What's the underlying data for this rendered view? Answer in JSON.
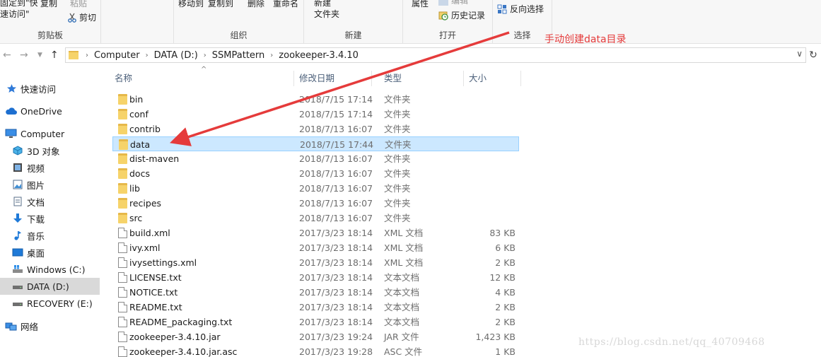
{
  "ribbon": {
    "pin_label": "固定到\"快\n速访问\"",
    "copy_label": "复制",
    "paste_label": "粘贴",
    "cut_label": "剪切",
    "clipboard_group": "剪贴板",
    "move_to_label": "移动到",
    "copy_to_label": "复制到",
    "delete_label": "删除",
    "rename_label": "重命名",
    "organize_group": "组织",
    "new_folder_label": "新建\n文件夹",
    "new_group": "新建",
    "properties_label": "属性",
    "edit_label": "编辑",
    "history_label": "历史记录",
    "open_group": "打开",
    "invert_selection_label": "反向选择",
    "select_group": "选择"
  },
  "address": {
    "crumbs": [
      "Computer",
      "DATA (D:)",
      "SSMPattern",
      "zookeeper-3.4.10"
    ]
  },
  "sidebar": {
    "items": [
      {
        "label": "快速访问",
        "icon": "star-icon"
      },
      {
        "label": "OneDrive",
        "icon": "cloud-icon"
      },
      {
        "label": "Computer",
        "icon": "computer-icon"
      },
      {
        "label": "3D 对象",
        "icon": "cube-icon"
      },
      {
        "label": "视频",
        "icon": "video-icon"
      },
      {
        "label": "图片",
        "icon": "picture-icon"
      },
      {
        "label": "文档",
        "icon": "document-icon"
      },
      {
        "label": "下载",
        "icon": "download-icon"
      },
      {
        "label": "音乐",
        "icon": "music-icon"
      },
      {
        "label": "桌面",
        "icon": "desktop-icon"
      },
      {
        "label": "Windows (C:)",
        "icon": "drive-icon"
      },
      {
        "label": "DATA (D:)",
        "icon": "drive-icon",
        "selected": true
      },
      {
        "label": "RECOVERY (E:)",
        "icon": "drive-icon"
      },
      {
        "label": "网络",
        "icon": "network-icon"
      }
    ]
  },
  "columns": {
    "name": "名称",
    "date": "修改日期",
    "type": "类型",
    "size": "大小"
  },
  "files": [
    {
      "name": "bin",
      "date": "2018/7/15 17:14",
      "type": "文件夹",
      "size": "",
      "kind": "folder"
    },
    {
      "name": "conf",
      "date": "2018/7/15 17:14",
      "type": "文件夹",
      "size": "",
      "kind": "folder"
    },
    {
      "name": "contrib",
      "date": "2018/7/13 16:07",
      "type": "文件夹",
      "size": "",
      "kind": "folder"
    },
    {
      "name": "data",
      "date": "2018/7/15 17:44",
      "type": "文件夹",
      "size": "",
      "kind": "folder",
      "selected": true
    },
    {
      "name": "dist-maven",
      "date": "2018/7/13 16:07",
      "type": "文件夹",
      "size": "",
      "kind": "folder"
    },
    {
      "name": "docs",
      "date": "2018/7/13 16:07",
      "type": "文件夹",
      "size": "",
      "kind": "folder"
    },
    {
      "name": "lib",
      "date": "2018/7/13 16:07",
      "type": "文件夹",
      "size": "",
      "kind": "folder"
    },
    {
      "name": "recipes",
      "date": "2018/7/13 16:07",
      "type": "文件夹",
      "size": "",
      "kind": "folder"
    },
    {
      "name": "src",
      "date": "2018/7/13 16:07",
      "type": "文件夹",
      "size": "",
      "kind": "folder"
    },
    {
      "name": "build.xml",
      "date": "2017/3/23 18:14",
      "type": "XML 文档",
      "size": "83 KB",
      "kind": "file"
    },
    {
      "name": "ivy.xml",
      "date": "2017/3/23 18:14",
      "type": "XML 文档",
      "size": "6 KB",
      "kind": "file"
    },
    {
      "name": "ivysettings.xml",
      "date": "2017/3/23 18:14",
      "type": "XML 文档",
      "size": "2 KB",
      "kind": "file"
    },
    {
      "name": "LICENSE.txt",
      "date": "2017/3/23 18:14",
      "type": "文本文档",
      "size": "12 KB",
      "kind": "file"
    },
    {
      "name": "NOTICE.txt",
      "date": "2017/3/23 18:14",
      "type": "文本文档",
      "size": "4 KB",
      "kind": "file"
    },
    {
      "name": "README.txt",
      "date": "2017/3/23 18:14",
      "type": "文本文档",
      "size": "2 KB",
      "kind": "file"
    },
    {
      "name": "README_packaging.txt",
      "date": "2017/3/23 18:14",
      "type": "文本文档",
      "size": "2 KB",
      "kind": "file"
    },
    {
      "name": "zookeeper-3.4.10.jar",
      "date": "2017/3/23 19:24",
      "type": "JAR 文件",
      "size": "1,423 KB",
      "kind": "file"
    },
    {
      "name": "zookeeper-3.4.10.jar.asc",
      "date": "2017/3/23 19:28",
      "type": "ASC 文件",
      "size": "1 KB",
      "kind": "file"
    }
  ],
  "annotation": "手动创建data目录",
  "watermark": "https://blog.csdn.net/qq_40709468",
  "colors": {
    "annotation": "#e53b3b",
    "selection": "#cce8ff",
    "folder": "#f6d36a"
  }
}
